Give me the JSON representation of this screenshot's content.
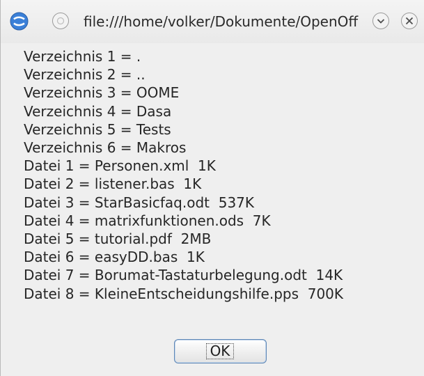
{
  "window": {
    "title": "file:///home/volker/Dokumente/OpenOff...",
    "app_icon": "openoffice-icon",
    "buttons": [
      "menu-button",
      "minimize-button",
      "close-button"
    ]
  },
  "message": {
    "lines": [
      "Verzeichnis 1 = .",
      "Verzeichnis 2 = ..",
      "Verzeichnis 3 = OOME",
      "Verzeichnis 4 = Dasa",
      "Verzeichnis 5 = Tests",
      "Verzeichnis 6 = Makros",
      "Datei 1 = Personen.xml  1K",
      "Datei 2 = listener.bas  1K",
      "Datei 3 = StarBasicfaq.odt  537K",
      "Datei 4 = matrixfunktionen.ods  7K",
      "Datei 5 = tutorial.pdf  2MB",
      "Datei 6 = easyDD.bas  1K",
      "Datei 7 = Borumat-Tastaturbelegung.odt  14K",
      "Datei 8 = KleineEntscheidungshilfe.pps  700K"
    ]
  },
  "actions": {
    "ok_label": "OK"
  },
  "colors": {
    "window_bg": "#efefef",
    "button_border": "#5d86b5",
    "text": "#262626"
  }
}
